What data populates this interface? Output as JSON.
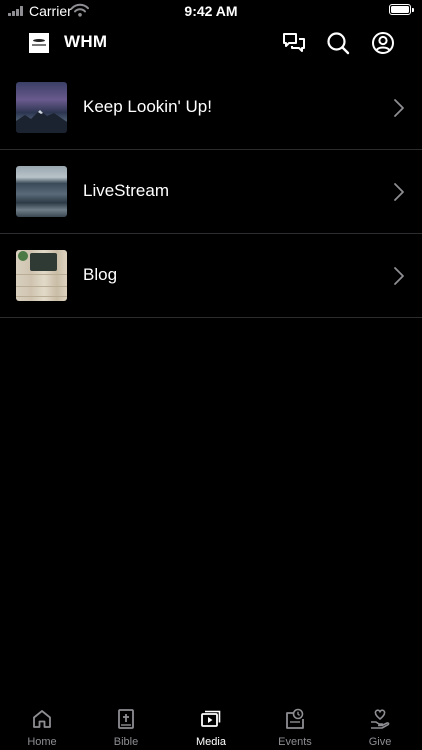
{
  "status_bar": {
    "carrier": "Carrier",
    "time": "9:42 AM"
  },
  "header": {
    "title": "WHM",
    "icons": [
      "chat-icon",
      "search-icon",
      "account-icon"
    ]
  },
  "media_items": [
    {
      "label": "Keep Lookin' Up!",
      "thumbnail": "mountain-night-sky"
    },
    {
      "label": "LiveStream",
      "thumbnail": "ocean-water"
    },
    {
      "label": "Blog",
      "thumbnail": "desk-typewriter"
    }
  ],
  "tabs": [
    {
      "label": "Home",
      "icon": "home-icon",
      "active": false
    },
    {
      "label": "Bible",
      "icon": "bible-icon",
      "active": false
    },
    {
      "label": "Media",
      "icon": "media-icon",
      "active": true
    },
    {
      "label": "Events",
      "icon": "events-icon",
      "active": false
    },
    {
      "label": "Give",
      "icon": "give-icon",
      "active": false
    }
  ],
  "colors": {
    "background": "#000000",
    "text": "#ffffff",
    "inactive_tab": "#8e8e93",
    "separator": "#2c2c2e"
  }
}
